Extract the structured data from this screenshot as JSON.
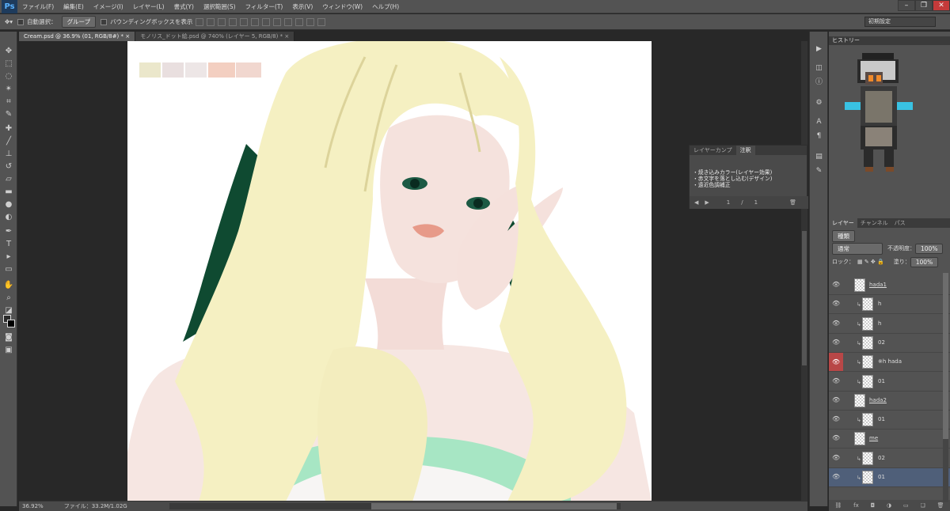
{
  "app": {
    "logo": "Ps"
  },
  "menu": [
    "ファイル(F)",
    "編集(E)",
    "イメージ(I)",
    "レイヤー(L)",
    "書式(Y)",
    "選択範囲(S)",
    "フィルター(T)",
    "表示(V)",
    "ウィンドウ(W)",
    "ヘルプ(H)"
  ],
  "window_controls": {
    "minimize": "–",
    "restore": "❐",
    "close": "✕"
  },
  "options": {
    "auto_select_label": "自動選択：",
    "auto_select_value": "グループ",
    "bbox_label": "バウンディングボックスを表示"
  },
  "workspace": "初期設定",
  "tabs": [
    {
      "label": "Cream.psd @ 36.9% (01, RGB/8#) *",
      "close": "×"
    },
    {
      "label": "モノリス_ドット絵.psd @ 740% (レイヤー 5, RGB/8) *",
      "close": "×"
    }
  ],
  "swatches": [
    "#ebe7cb",
    "#e9dfdf",
    "#ede6e6",
    "#f3cfc1",
    "#f1d7cf"
  ],
  "notes_panel": {
    "tabs": [
      "レイヤーカンプ",
      "注釈"
    ],
    "lines": [
      "・焼き込みカラー(レイヤー効果)",
      "・赤文字を落とし込む(デザイン)",
      "・遠近色調補正"
    ],
    "page_current": "1",
    "page_sep": "/",
    "page_total": "1"
  },
  "status": {
    "zoom": "36.92%",
    "file": "ファイル：33.2M/1.02G"
  },
  "history": {
    "title": "ヒストリー"
  },
  "layers_panel": {
    "tabs": [
      "レイヤー",
      "チャンネル",
      "パス"
    ],
    "filter": "種類",
    "blend": "通常",
    "opacity_label": "不透明度：",
    "opacity": "100%",
    "lock_label": "ロック：",
    "fill_label": "塗り：",
    "fill": "100%",
    "layers": [
      {
        "name": "hada1",
        "group": true
      },
      {
        "name": "h",
        "clip": true
      },
      {
        "name": "h",
        "clip": true
      },
      {
        "name": "02",
        "clip": true
      },
      {
        "name": "※h hada",
        "clip": true,
        "highlight": true
      },
      {
        "name": "01",
        "clip": true
      },
      {
        "name": "hada2",
        "group": true
      },
      {
        "name": "01",
        "clip": true
      },
      {
        "name": "me",
        "group": true
      },
      {
        "name": "02",
        "clip": true
      },
      {
        "name": "01",
        "clip": true,
        "selected": true
      }
    ]
  }
}
